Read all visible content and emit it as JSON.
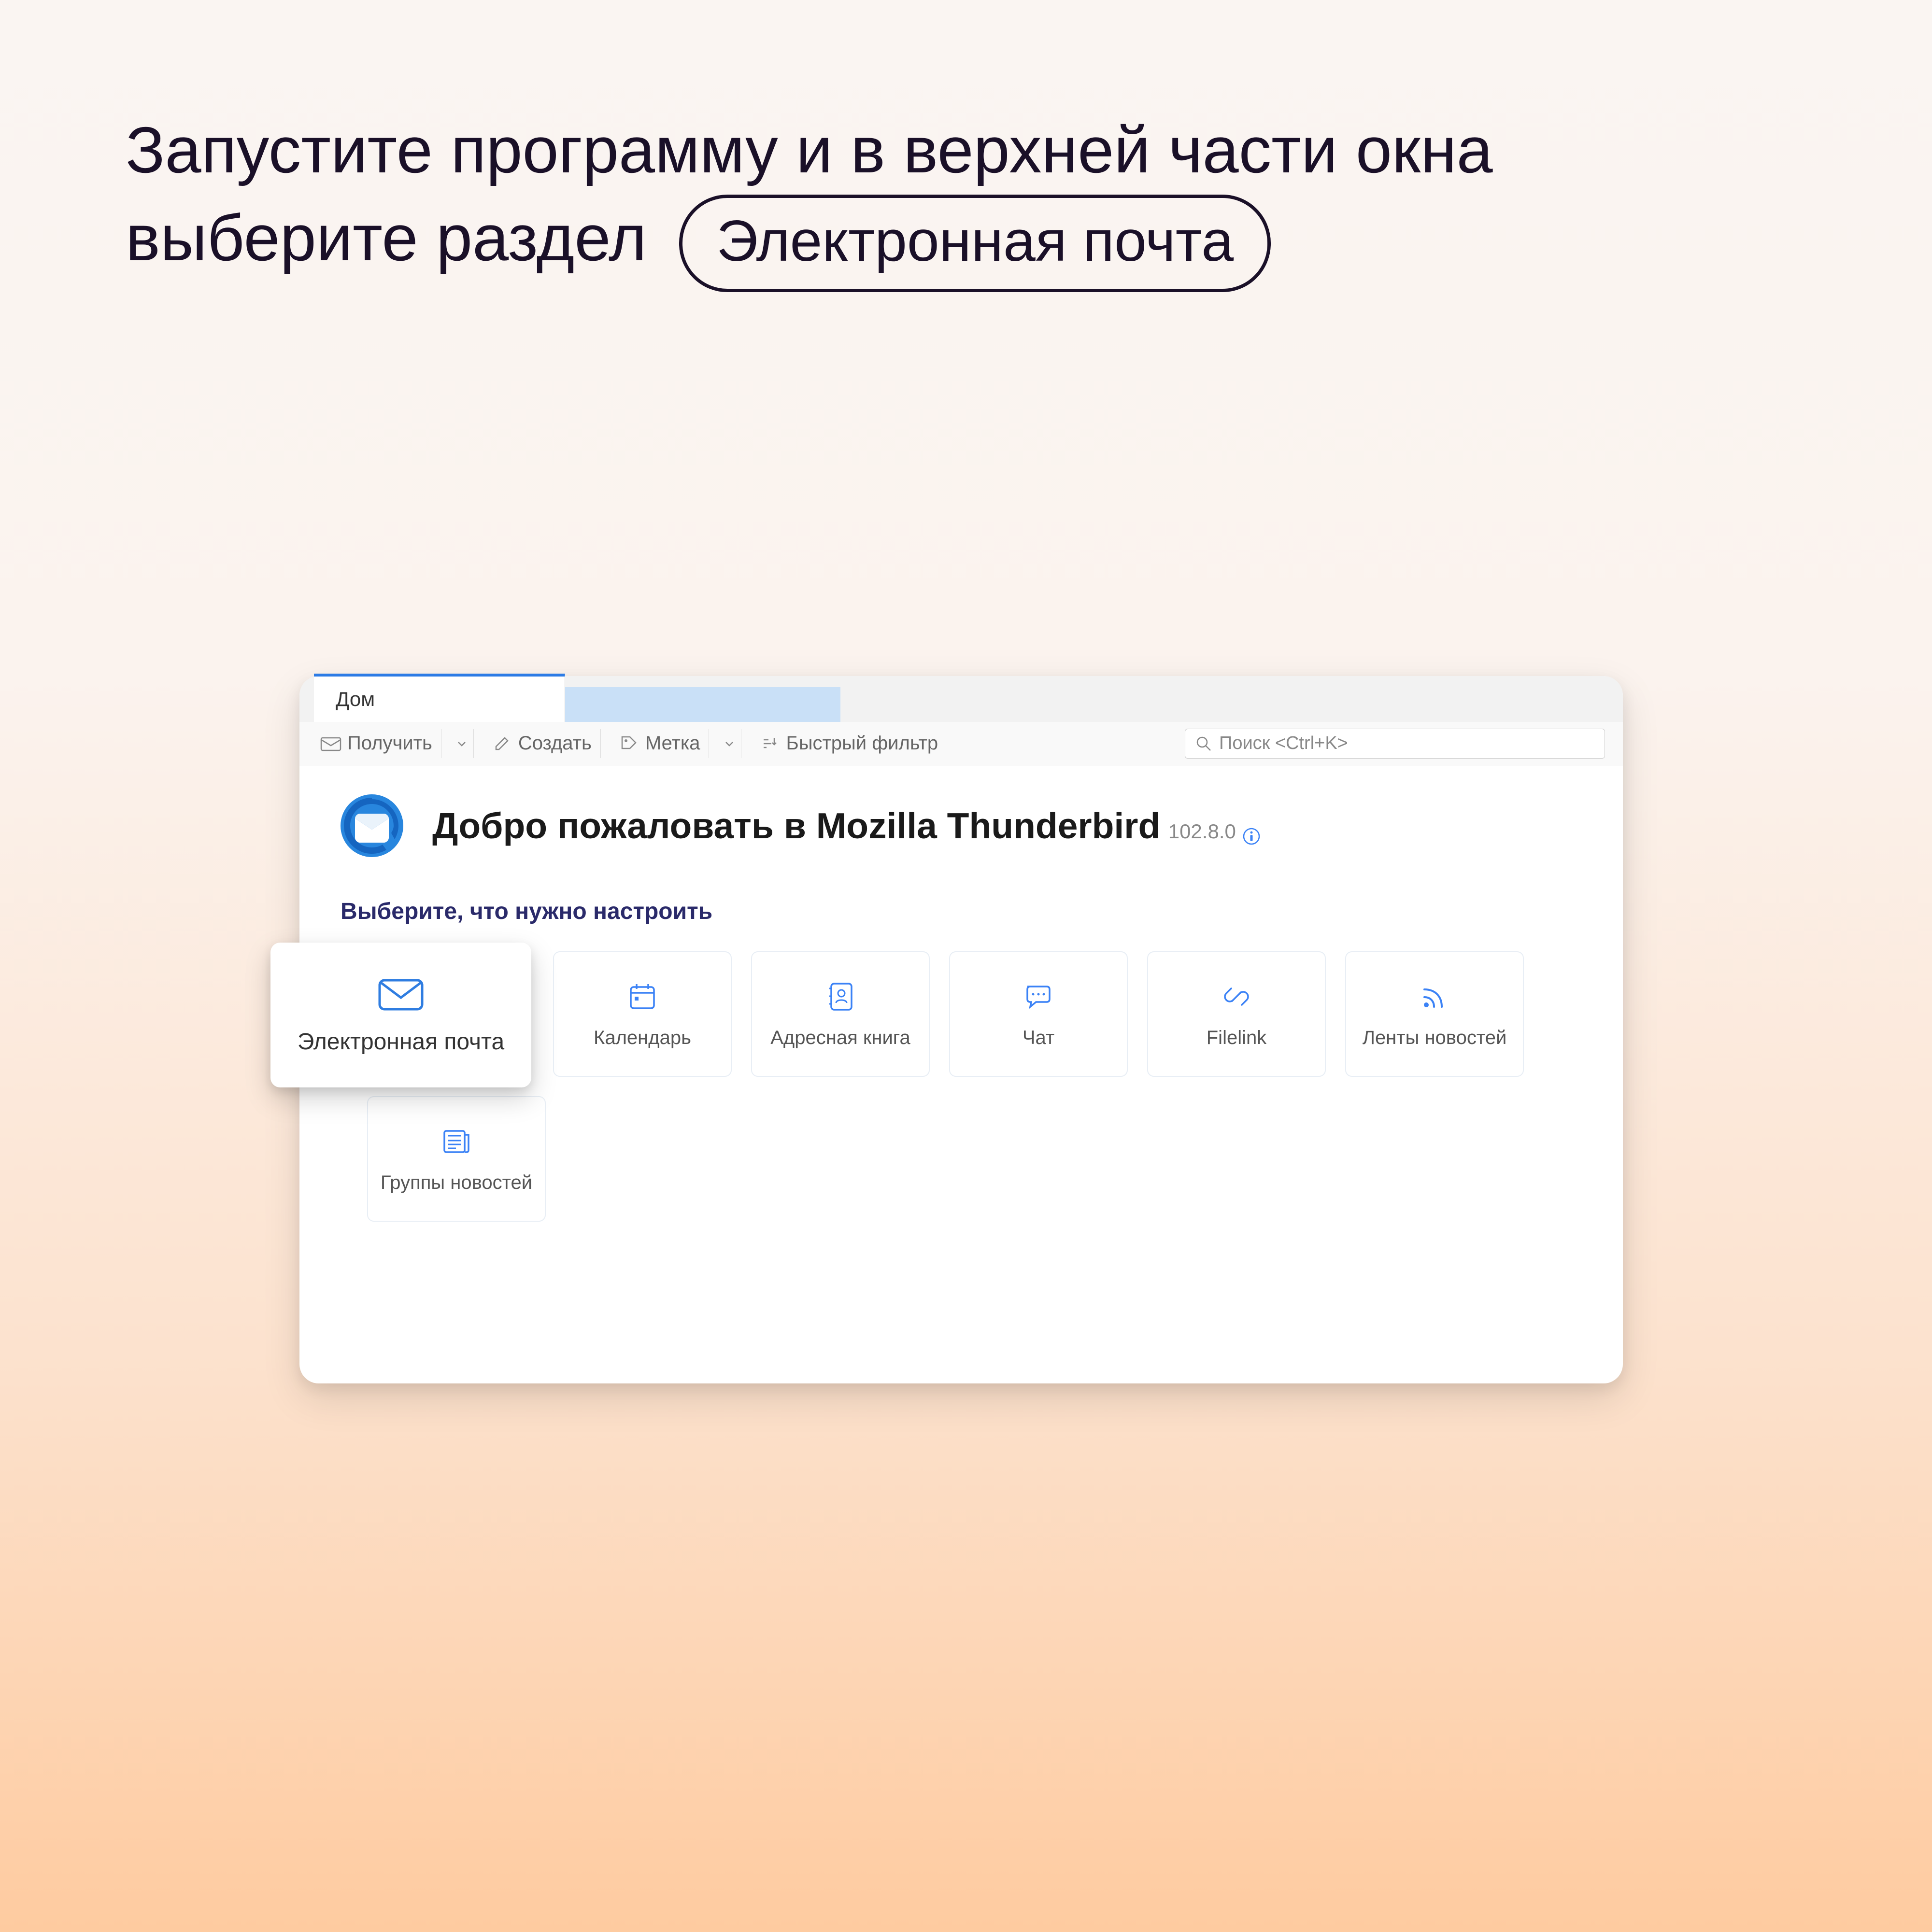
{
  "instruction": {
    "line1": "Запустите программу и в верхней части окна",
    "line2_prefix": "выберите раздел",
    "pill": "Электронная почта"
  },
  "tabs": {
    "active": "Дом"
  },
  "toolbar": {
    "receive": "Получить",
    "create": "Создать",
    "tag": "Метка",
    "quick_filter": "Быстрый фильтр"
  },
  "search": {
    "placeholder": "Поиск <Ctrl+K>"
  },
  "welcome": {
    "title": "Добро пожаловать в Mozilla Thunderbird",
    "version": "102.8.0"
  },
  "subtitle": "Выберите, что нужно настроить",
  "cards": {
    "email": "Электронная почта",
    "calendar": "Календарь",
    "address_book": "Адресная книга",
    "chat": "Чат",
    "filelink": "Filelink",
    "feeds": "Ленты новостей",
    "newsgroups": "Группы новостей"
  }
}
